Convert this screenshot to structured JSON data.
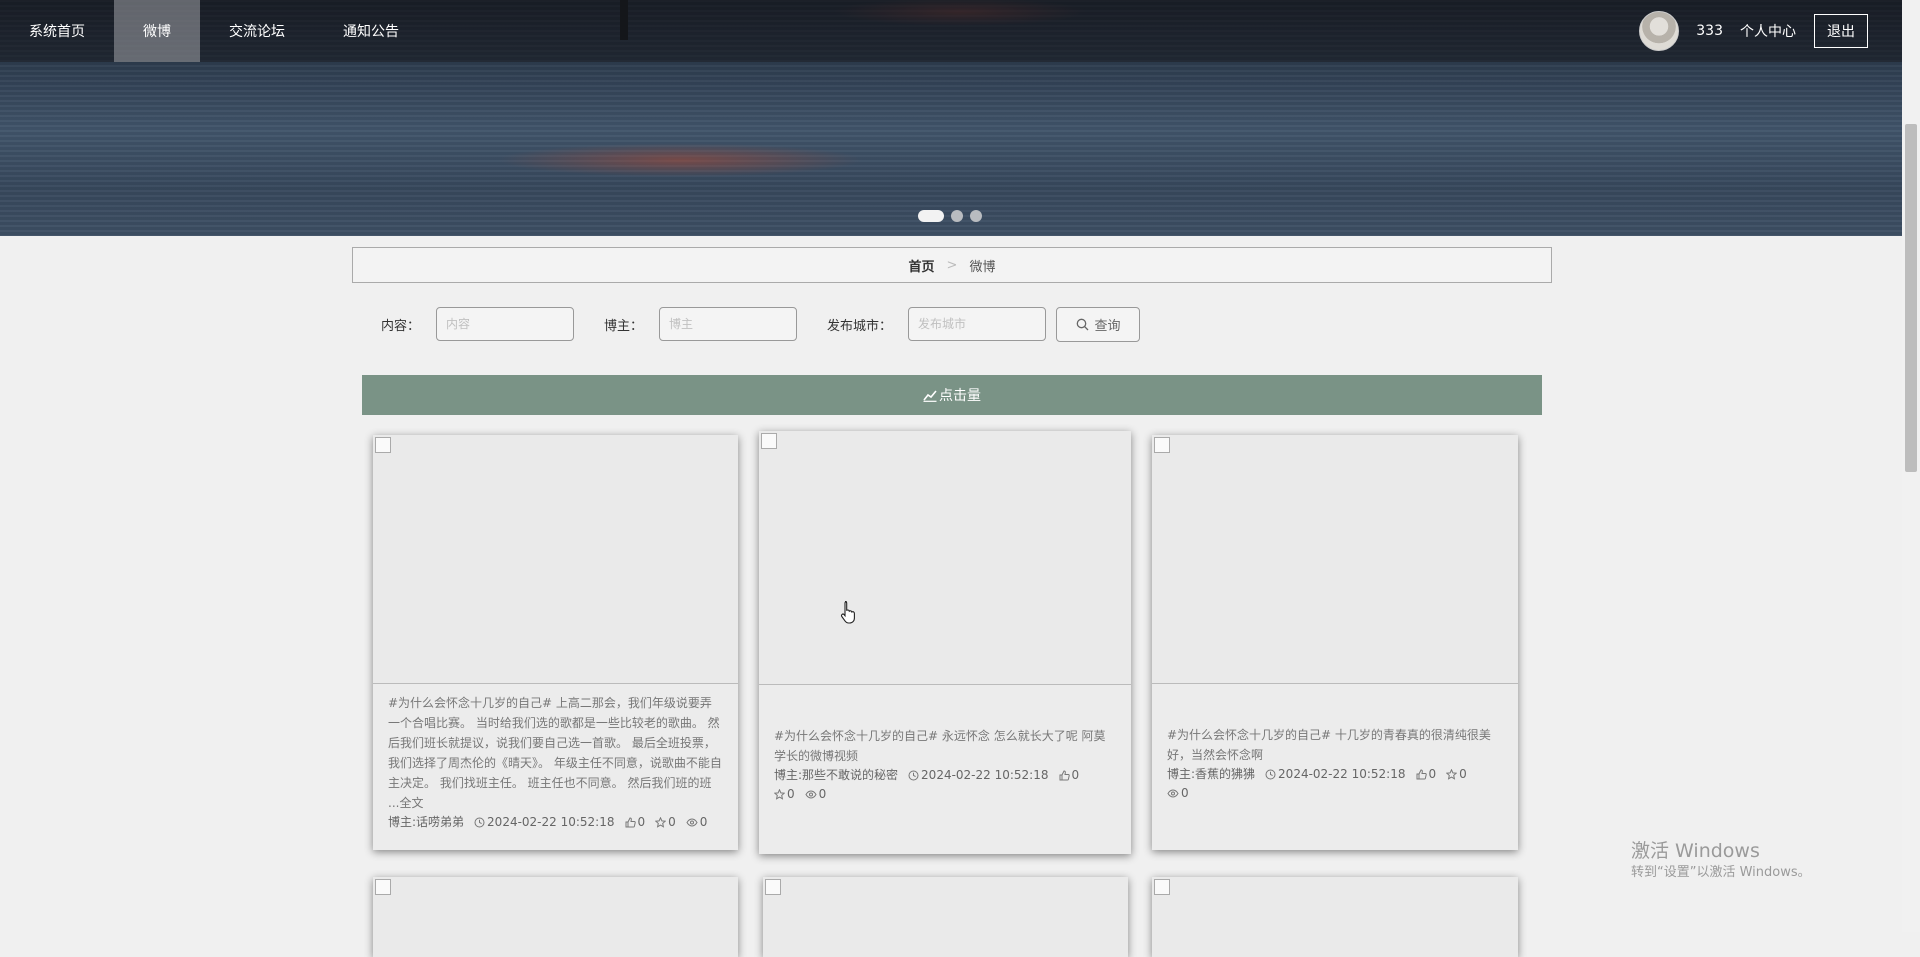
{
  "nav": {
    "items": [
      {
        "label": "系统首页",
        "active": false
      },
      {
        "label": "微博",
        "active": true
      },
      {
        "label": "交流论坛",
        "active": false
      },
      {
        "label": "通知公告",
        "active": false
      }
    ],
    "user_name": "333",
    "personal_center": "个人中心",
    "logout": "退出"
  },
  "banner": {
    "slide_count": 3,
    "active_slide": 1
  },
  "breadcrumb": {
    "home": "首页",
    "separator": ">",
    "current": "微博"
  },
  "search": {
    "content_label": "内容：",
    "content_placeholder": "内容",
    "author_label": "博主：",
    "author_placeholder": "博主",
    "city_label": "发布城市：",
    "city_placeholder": "发布城市",
    "query_button": "查询"
  },
  "sort_bar": {
    "label": "点击量",
    "icon": "chart-icon",
    "color": "#7a9386"
  },
  "cards": [
    {
      "text": "#为什么会怀念十几岁的自己# 上高二那会，我们年级说要弄一个合唱比赛。 当时给我们选的歌都是一些比较老的歌曲。 然后我们班长就提议，说我们要自己选一首歌。 最后全班投票，我们选择了周杰伦的《晴天》。 年级主任不同意，说歌曲不能自主决定。 我们找班主任。 班主任也不同意。 然后我们班的班 ...全文",
      "author": "博主:话唠弟弟",
      "time": "2024-02-22 10:52:18",
      "likes": "0",
      "favorites": "0",
      "views": "0"
    },
    {
      "text": "#为什么会怀念十几岁的自己# 永远怀念 怎么就长大了呢 阿莫学长的微博视频",
      "author": "博主:那些不敢说的秘密",
      "time": "2024-02-22 10:52:18",
      "likes": "0",
      "favorites": "0",
      "views": "0"
    },
    {
      "text": "#为什么会怀念十几岁的自己# 十几岁的青春真的很清纯很美好，当然会怀念啊",
      "author": "博主:香蕉的狒狒",
      "time": "2024-02-22 10:52:18",
      "likes": "0",
      "favorites": "0",
      "views": "0"
    }
  ],
  "watermark": {
    "line1": "激活 Windows",
    "line2": "转到“设置”以激活 Windows。"
  }
}
